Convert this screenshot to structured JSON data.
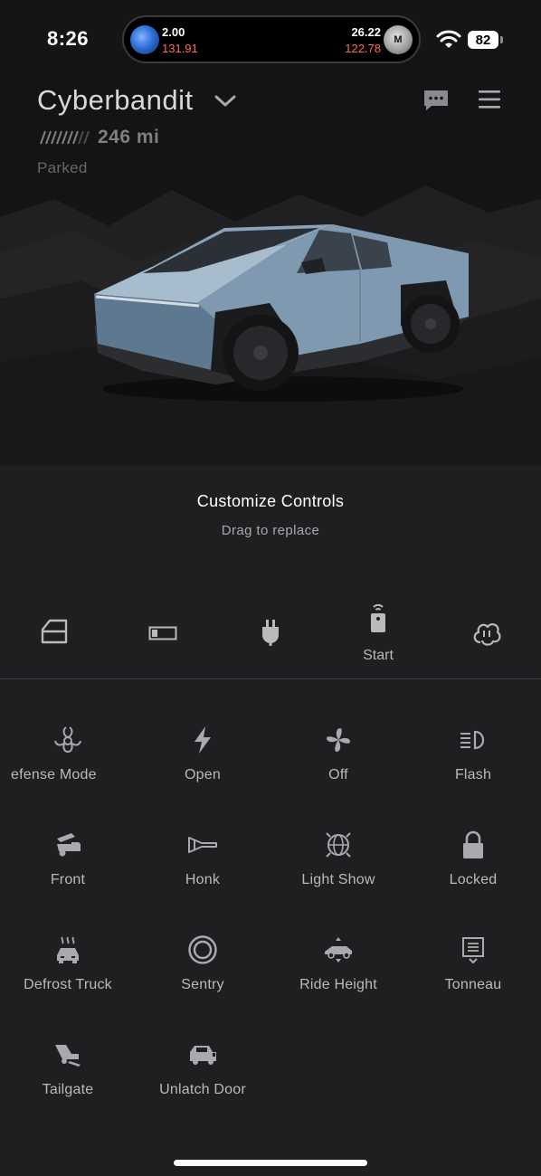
{
  "status_bar": {
    "time": "8:26",
    "ticker_left_value": "2.00",
    "ticker_left_sub": "131.91",
    "ticker_right_value": "26.22",
    "ticker_right_sub": "122.78",
    "ticker_right_badge": "M",
    "battery_level": "82"
  },
  "vehicle": {
    "name": "Cyberbandit",
    "range": "246 mi",
    "state": "Parked"
  },
  "controls": {
    "title": "Customize Controls",
    "subtitle": "Drag to replace",
    "bar": [
      {
        "icon": "door-icon",
        "label": ""
      },
      {
        "icon": "battery-icon",
        "label": ""
      },
      {
        "icon": "charge-plug-icon",
        "label": ""
      },
      {
        "icon": "remote-start-icon",
        "label": "Start"
      },
      {
        "icon": "climate-fan-icon",
        "label": ""
      }
    ],
    "grid": [
      {
        "icon": "biohazard-icon",
        "label": "efense Mode"
      },
      {
        "icon": "lightning-icon",
        "label": "Open"
      },
      {
        "icon": "fan-icon",
        "label": "Off"
      },
      {
        "icon": "headlight-icon",
        "label": "Flash"
      },
      {
        "icon": "frunk-icon",
        "label": "Front"
      },
      {
        "icon": "horn-icon",
        "label": "Honk"
      },
      {
        "icon": "light-show-icon",
        "label": "Light Show"
      },
      {
        "icon": "lock-icon",
        "label": "Locked"
      },
      {
        "icon": "defrost-icon",
        "label": "Defrost Truck"
      },
      {
        "icon": "sentry-icon",
        "label": "Sentry"
      },
      {
        "icon": "ride-height-icon",
        "label": "Ride Height"
      },
      {
        "icon": "tonneau-icon",
        "label": "Tonneau"
      },
      {
        "icon": "tailgate-icon",
        "label": "Tailgate"
      },
      {
        "icon": "unlatch-door-icon",
        "label": "Unlatch Door"
      }
    ]
  },
  "colors": {
    "background": "#1e1f21",
    "text_primary": "#ffffff",
    "text_secondary": "#b9babc",
    "ticker_down": "#ff6b5e",
    "truck_body": "#8aa3b8"
  }
}
